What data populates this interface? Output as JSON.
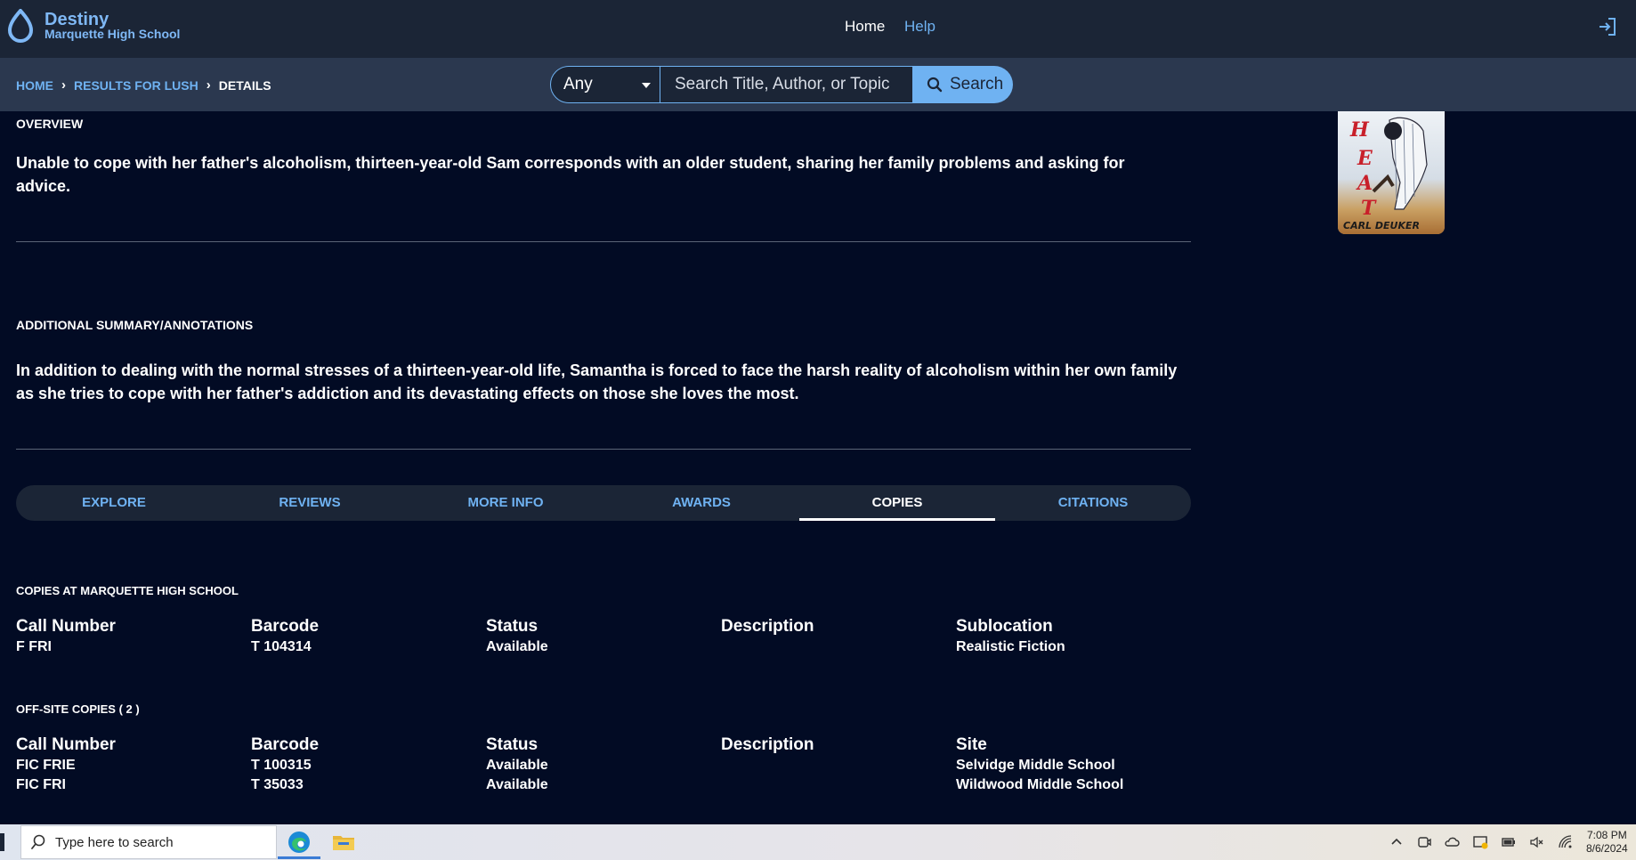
{
  "header": {
    "brand_name": "Destiny",
    "school_name": "Marquette High School",
    "nav": {
      "home": "Home",
      "help": "Help"
    }
  },
  "breadcrumb": {
    "home": "HOME",
    "results": "RESULTS FOR LUSH",
    "current": "DETAILS"
  },
  "search": {
    "scope_value": "Any",
    "placeholder": "Search Title, Author, or Topic",
    "button_label": "Search"
  },
  "book_cover": {
    "letters": [
      "H",
      "E",
      "A",
      "T"
    ],
    "author": "CARL DEUKER"
  },
  "overview": {
    "title": "OVERVIEW",
    "text": "Unable to cope with her father's alcoholism, thirteen-year-old Sam corresponds with an older student, sharing her family problems and asking for advice."
  },
  "summary": {
    "title": "ADDITIONAL SUMMARY/ANNOTATIONS",
    "text": "In addition to dealing with the normal stresses of a thirteen-year-old life, Samantha is forced to face the harsh reality of alcoholism within her own family as she tries to cope with her father's addiction and its devastating effects on those she loves the most."
  },
  "tabs": [
    {
      "label": "EXPLORE"
    },
    {
      "label": "REVIEWS"
    },
    {
      "label": "MORE INFO"
    },
    {
      "label": "AWARDS"
    },
    {
      "label": "COPIES"
    },
    {
      "label": "CITATIONS"
    }
  ],
  "active_tab": "COPIES",
  "local_copies": {
    "title": "COPIES AT MARQUETTE HIGH SCHOOL",
    "headers": [
      "Call Number",
      "Barcode",
      "Status",
      "Description",
      "Sublocation"
    ],
    "rows": [
      [
        "F FRI",
        "T 104314",
        "Available",
        "",
        "Realistic Fiction"
      ]
    ]
  },
  "offsite_copies": {
    "title": "OFF-SITE COPIES ( 2 )",
    "headers": [
      "Call Number",
      "Barcode",
      "Status",
      "Description",
      "Site"
    ],
    "rows": [
      [
        "FIC FRIE",
        "T 100315",
        "Available",
        "",
        "Selvidge Middle School"
      ],
      [
        "FIC FRI",
        "T 35033",
        "Available",
        "",
        "Wildwood Middle School"
      ]
    ]
  },
  "taskbar": {
    "search_placeholder": "Type here to search",
    "time": "7:08 PM",
    "date": "8/6/2024"
  },
  "colors": {
    "background": "#020b24",
    "header": "#1b2536",
    "subbar": "#2b384f",
    "link": "#6fb2f2",
    "search_button": "#6fb2f2"
  }
}
